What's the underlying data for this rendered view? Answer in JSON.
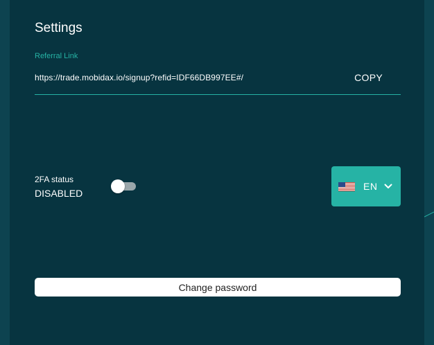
{
  "settings": {
    "title": "Settings",
    "referral": {
      "label": "Referral Link",
      "url": "https://trade.mobidax.io/signup?refid=IDF66DB997EE#/",
      "copy_label": "COPY"
    },
    "twofa": {
      "label": "2FA status",
      "value": "DISABLED",
      "enabled": false
    },
    "language": {
      "code": "EN",
      "flag_icon": "us-flag-icon"
    },
    "change_password_label": "Change password"
  },
  "colors": {
    "background": "#073440",
    "accent": "#26b3a5",
    "text": "#ffffff"
  }
}
